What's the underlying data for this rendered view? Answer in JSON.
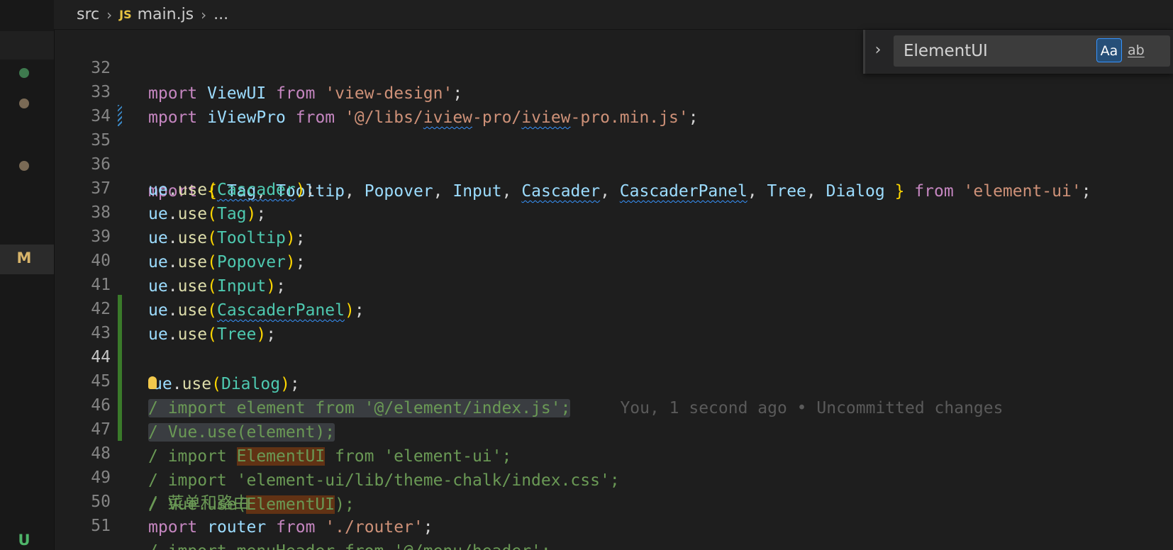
{
  "breadcrumb": {
    "folder": "src",
    "file_badge": "JS",
    "file": "main.js",
    "more": "..."
  },
  "left_rail": {
    "dot_colors": [
      "#3e7a4e",
      "#7a6a55",
      "#7a6a55"
    ],
    "m_label": "M",
    "u_label": "U"
  },
  "find_widget": {
    "query": "ElementUI",
    "match_case_label": "Aa",
    "whole_word_label": "ab"
  },
  "blame": "You, 1 second ago • Uncommitted changes",
  "lines": {
    "32": {
      "num": "32"
    },
    "33": {
      "num": "33"
    },
    "34": {
      "num": "34"
    },
    "35": {
      "num": "35"
    },
    "36": {
      "num": "36"
    },
    "37": {
      "num": "37"
    },
    "38": {
      "num": "38"
    },
    "39": {
      "num": "39"
    },
    "40": {
      "num": "40"
    },
    "41": {
      "num": "41"
    },
    "42": {
      "num": "42"
    },
    "43": {
      "num": "43"
    },
    "44": {
      "num": "44"
    },
    "45": {
      "num": "45"
    },
    "46": {
      "num": "46"
    },
    "47": {
      "num": "47"
    },
    "48": {
      "num": "48"
    },
    "49": {
      "num": "49"
    },
    "50": {
      "num": "50"
    },
    "51": {
      "num": "51"
    }
  },
  "tokens": {
    "import_trunc": "mport",
    "vue_trunc": "ue",
    "use": "use",
    "from": "from",
    "viewui": "ViewUI",
    "view_design": "'view-design'",
    "iviewpro": "iViewPro",
    "iview_path_1": "'@/libs/",
    "iview_path_2": "iview",
    "iview_path_3": "-pro/",
    "iview_path_4": "iview",
    "iview_path_5": "-pro.min.js'",
    "tag": "Tag",
    "tooltip": "Tooltip",
    "popover": "Popover",
    "input": "Input",
    "cascader": "Cascader",
    "cascader_panel": "CascaderPanel",
    "tree": "Tree",
    "dialog": "Dialog",
    "element_ui_str": "'element-ui'",
    "cmt_44": "/ import element from '@/element/index.js';",
    "cmt_45": "/ Vue.use(element);",
    "cmt_46_a": "/ import ",
    "cmt_46_b": "ElementUI",
    "cmt_46_c": " from 'element-ui';",
    "cmt_47": "/ import 'element-ui/lib/theme-chalk/index.css';",
    "cmt_48_a": "/ Vue.use(",
    "cmt_48_b": "ElementUI",
    "cmt_48_c": ");",
    "cmt_49": "/ 菜单和路由",
    "router": "router",
    "router_path": "'./router'",
    "cmt_51": "/ import menuHeader from '@/menu/header';"
  }
}
